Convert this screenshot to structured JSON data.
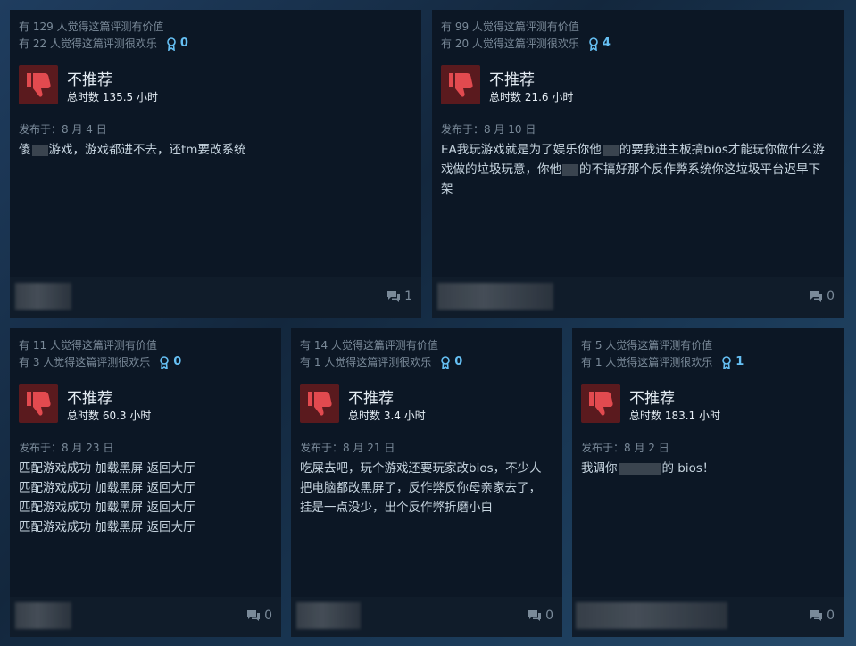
{
  "reviews": [
    {
      "helpful": "有 129 人觉得这篇评测有价值",
      "funny": "有 22 人觉得这篇评测很欢乐",
      "awards": "0",
      "verdict": "不推荐",
      "hours": "总时数 135.5 小时",
      "posted": "发布于：8 月 4 日",
      "content_parts": [
        "傻",
        "游戏，游戏都进不去，还tm要改系统"
      ],
      "comments": "1"
    },
    {
      "helpful": "有 99 人觉得这篇评测有价值",
      "funny": "有 20 人觉得这篇评测很欢乐",
      "awards": "4",
      "verdict": "不推荐",
      "hours": "总时数 21.6 小时",
      "posted": "发布于：8 月 10 日",
      "content_parts": [
        "EA我玩游戏就是为了娱乐你他",
        "的要我进主板搞bios才能玩你做什么游",
        "戏做的垃圾玩意，你他",
        "的不搞好那个反作弊系统你这垃圾平台迟早下",
        "架"
      ],
      "comments": "0"
    },
    {
      "helpful": "有 11 人觉得这篇评测有价值",
      "funny": "有 3 人觉得这篇评测很欢乐",
      "awards": "0",
      "verdict": "不推荐",
      "hours": "总时数 60.3 小时",
      "posted": "发布于：8 月 23 日",
      "content_lines": [
        "匹配游戏成功 加载黑屏 返回大厅",
        "匹配游戏成功 加载黑屏 返回大厅",
        "匹配游戏成功 加载黑屏 返回大厅",
        "匹配游戏成功 加载黑屏 返回大厅"
      ],
      "comments": "0"
    },
    {
      "helpful": "有 14 人觉得这篇评测有价值",
      "funny": "有 1 人觉得这篇评测很欢乐",
      "awards": "0",
      "verdict": "不推荐",
      "hours": "总时数 3.4 小时",
      "posted": "发布于：8 月 21 日",
      "content_lines": [
        "吃屎去吧，玩个游戏还要玩家改bios，不少人",
        "把电脑都改黑屏了，反作弊反你母亲家去了，",
        "挂是一点没少，出个反作弊折磨小白"
      ],
      "comments": "0"
    },
    {
      "helpful": "有 5 人觉得这篇评测有价值",
      "funny": "有 1 人觉得这篇评测很欢乐",
      "awards": "1",
      "verdict": "不推荐",
      "hours": "总时数 183.1 小时",
      "posted": "发布于：8 月 2 日",
      "content_parts": [
        "我调你",
        "的 bios！"
      ],
      "comments": "0"
    }
  ],
  "icons": {
    "thumb": "thumbs-down-icon",
    "award": "award-ribbon-icon",
    "comment": "comment-bubble-icon"
  },
  "colors": {
    "card_bg": "#0c1725",
    "thumb_bg": "#5a1a1e",
    "thumb_fg": "#e24a4f",
    "award": "#66c0f4",
    "muted": "#7a8a99"
  }
}
